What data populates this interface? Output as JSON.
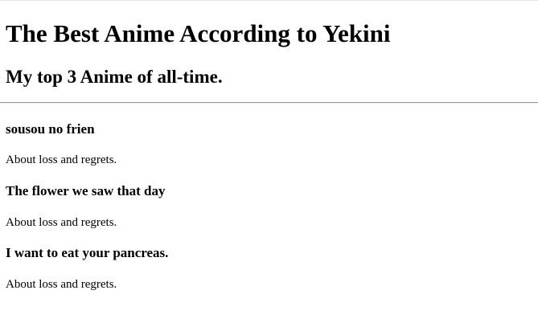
{
  "page": {
    "title": "The Best Anime According to Yekini",
    "subtitle": "My top 3 Anime of all-time."
  },
  "anime": [
    {
      "title": "sousou no frien",
      "description": "About loss and regrets."
    },
    {
      "title": "The flower we saw that day",
      "description": "About loss and regrets."
    },
    {
      "title": "I want to eat your pancreas.",
      "description": "About loss and regrets."
    }
  ]
}
